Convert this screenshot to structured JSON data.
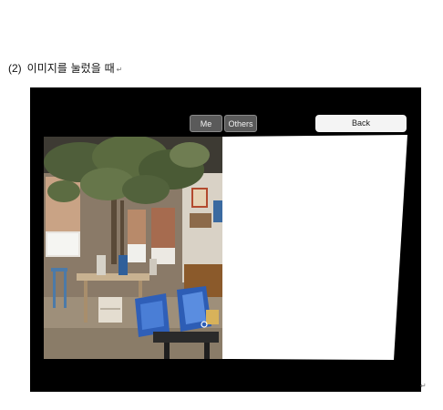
{
  "caption": {
    "number": "(2)",
    "text": "이미지를 눌렀을 때",
    "mark": "↵"
  },
  "app": {
    "buttons": {
      "me": "Me",
      "others": "Others",
      "back": "Back"
    }
  },
  "trailing_mark": "↵",
  "colors": {
    "frame": "#000000",
    "panel": "#ffffff",
    "dark_button": "#5a5a5a",
    "back_button": "#f4f4f4"
  }
}
